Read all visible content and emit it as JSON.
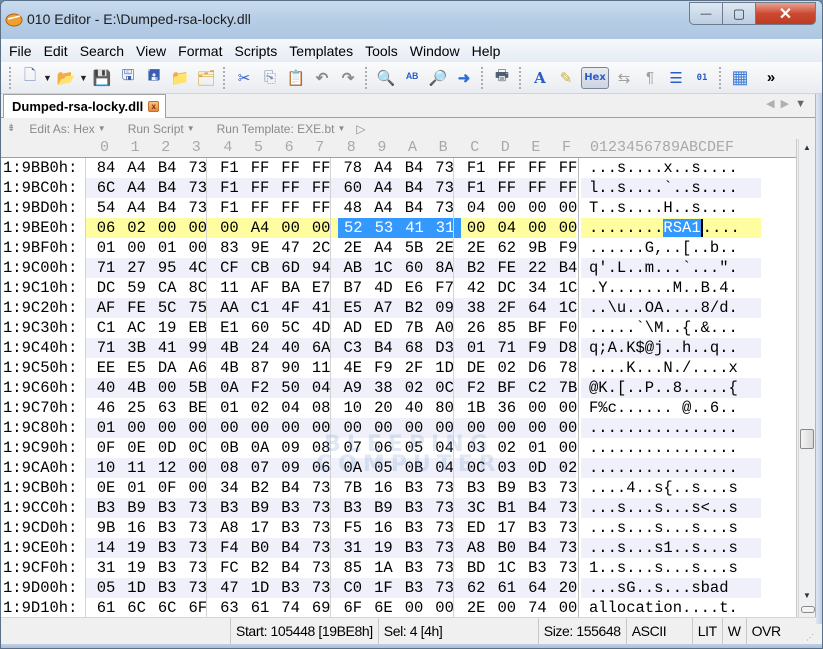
{
  "window": {
    "title": "010 Editor - E:\\Dumped-rsa-locky.dll",
    "controls": {
      "minimize": "—",
      "maximize": "▢",
      "close": "✕"
    }
  },
  "menu": [
    "File",
    "Edit",
    "Search",
    "View",
    "Format",
    "Scripts",
    "Templates",
    "Tools",
    "Window",
    "Help"
  ],
  "toolbar": {
    "icons": [
      {
        "name": "new-file-icon",
        "glyph": "🗋"
      },
      {
        "name": "open-file-icon",
        "glyph": "📂"
      },
      {
        "name": "save-icon",
        "glyph": "💾"
      },
      {
        "name": "save-as-icon",
        "glyph": "🖫"
      },
      {
        "name": "save-all-icon",
        "glyph": "🖪"
      },
      {
        "name": "open-folder-icon",
        "glyph": "📁"
      },
      {
        "name": "workspace-icon",
        "glyph": "🗂"
      },
      {
        "name": "cut-icon",
        "glyph": "✂"
      },
      {
        "name": "copy-icon",
        "glyph": "⎘"
      },
      {
        "name": "paste-icon",
        "glyph": "📋"
      },
      {
        "name": "undo-icon",
        "glyph": "↶"
      },
      {
        "name": "redo-icon",
        "glyph": "↷"
      },
      {
        "name": "find-icon",
        "glyph": "🔍"
      },
      {
        "name": "replace-icon",
        "glyph": "ᴬᴮ"
      },
      {
        "name": "find-in-files-icon",
        "glyph": "🔎"
      },
      {
        "name": "goto-icon",
        "glyph": "➜"
      },
      {
        "name": "print-icon",
        "glyph": "🖶"
      },
      {
        "name": "font-icon",
        "glyph": "A"
      },
      {
        "name": "highlight-icon",
        "glyph": "✎"
      },
      {
        "name": "columns-icon",
        "glyph": "⇆"
      },
      {
        "name": "pilcrow-icon",
        "glyph": "¶"
      },
      {
        "name": "list-view-icon",
        "glyph": "☰"
      },
      {
        "name": "binary-icon",
        "glyph": "01"
      },
      {
        "name": "calculator-icon",
        "glyph": "▦"
      }
    ],
    "hex_label": "Hex",
    "overflow": "»"
  },
  "tab": {
    "label": "Dumped-rsa-locky.dll",
    "close": "x"
  },
  "tab_nav": {
    "left": "◀",
    "right": "▶",
    "menu": "▼"
  },
  "editor_toolbar": {
    "edit_as": "Edit As: Hex",
    "run_script": "Run Script",
    "run_template": "Run Template: EXE.bt"
  },
  "column_header": {
    "hex": [
      "0",
      "1",
      "2",
      "3",
      "4",
      "5",
      "6",
      "7",
      "8",
      "9",
      "A",
      "B",
      "C",
      "D",
      "E",
      "F"
    ],
    "ascii": "0123456789ABCDEF"
  },
  "rows": [
    {
      "addr": "1:9BB0h:",
      "bytes": [
        "84",
        "A4",
        "B4",
        "73",
        "F1",
        "FF",
        "FF",
        "FF",
        "78",
        "A4",
        "B4",
        "73",
        "F1",
        "FF",
        "FF",
        "FF"
      ],
      "ascii": "...s....x..s...."
    },
    {
      "addr": "1:9BC0h:",
      "bytes": [
        "6C",
        "A4",
        "B4",
        "73",
        "F1",
        "FF",
        "FF",
        "FF",
        "60",
        "A4",
        "B4",
        "73",
        "F1",
        "FF",
        "FF",
        "FF"
      ],
      "ascii": "l..s....`..s...."
    },
    {
      "addr": "1:9BD0h:",
      "bytes": [
        "54",
        "A4",
        "B4",
        "73",
        "F1",
        "FF",
        "FF",
        "FF",
        "48",
        "A4",
        "B4",
        "73",
        "04",
        "00",
        "00",
        "00"
      ],
      "ascii": "T..s....H..s...."
    },
    {
      "addr": "1:9BE0h:",
      "bytes": [
        "06",
        "02",
        "00",
        "00",
        "00",
        "A4",
        "00",
        "00",
        "52",
        "53",
        "41",
        "31",
        "00",
        "04",
        "00",
        "00"
      ],
      "ascii": "........RSA1....",
      "highlight": true,
      "selection": [
        8,
        11
      ]
    },
    {
      "addr": "1:9BF0h:",
      "bytes": [
        "01",
        "00",
        "01",
        "00",
        "83",
        "9E",
        "47",
        "2C",
        "2E",
        "A4",
        "5B",
        "2E",
        "2E",
        "62",
        "9B",
        "F9"
      ],
      "ascii": "......G,..[..b.."
    },
    {
      "addr": "1:9C00h:",
      "bytes": [
        "71",
        "27",
        "95",
        "4C",
        "CF",
        "CB",
        "6D",
        "94",
        "AB",
        "1C",
        "60",
        "8A",
        "B2",
        "FE",
        "22",
        "B4"
      ],
      "ascii": "q'.L..m...`...\"."
    },
    {
      "addr": "1:9C10h:",
      "bytes": [
        "DC",
        "59",
        "CA",
        "8C",
        "11",
        "AF",
        "BA",
        "E7",
        "B7",
        "4D",
        "E6",
        "F7",
        "42",
        "DC",
        "34",
        "1C"
      ],
      "ascii": ".Y.......M..B.4."
    },
    {
      "addr": "1:9C20h:",
      "bytes": [
        "AF",
        "FE",
        "5C",
        "75",
        "AA",
        "C1",
        "4F",
        "41",
        "E5",
        "A7",
        "B2",
        "09",
        "38",
        "2F",
        "64",
        "1C"
      ],
      "ascii": "..\\u..OA....8/d."
    },
    {
      "addr": "1:9C30h:",
      "bytes": [
        "C1",
        "AC",
        "19",
        "EB",
        "E1",
        "60",
        "5C",
        "4D",
        "AD",
        "ED",
        "7B",
        "A0",
        "26",
        "85",
        "BF",
        "F0"
      ],
      "ascii": ".....`\\M..{.&..."
    },
    {
      "addr": "1:9C40h:",
      "bytes": [
        "71",
        "3B",
        "41",
        "99",
        "4B",
        "24",
        "40",
        "6A",
        "C3",
        "B4",
        "68",
        "D3",
        "01",
        "71",
        "F9",
        "D8"
      ],
      "ascii": "q;A.K$@j..h..q.."
    },
    {
      "addr": "1:9C50h:",
      "bytes": [
        "EE",
        "E5",
        "DA",
        "A6",
        "4B",
        "87",
        "90",
        "11",
        "4E",
        "F9",
        "2F",
        "1D",
        "DE",
        "02",
        "D6",
        "78"
      ],
      "ascii": "....K...N./....x"
    },
    {
      "addr": "1:9C60h:",
      "bytes": [
        "40",
        "4B",
        "00",
        "5B",
        "0A",
        "F2",
        "50",
        "04",
        "A9",
        "38",
        "02",
        "0C",
        "F2",
        "BF",
        "C2",
        "7B"
      ],
      "ascii": "@K.[..P..8.....{"
    },
    {
      "addr": "1:9C70h:",
      "bytes": [
        "46",
        "25",
        "63",
        "BE",
        "01",
        "02",
        "04",
        "08",
        "10",
        "20",
        "40",
        "80",
        "1B",
        "36",
        "00",
        "00"
      ],
      "ascii": "F%c...... @..6.."
    },
    {
      "addr": "1:9C80h:",
      "bytes": [
        "01",
        "00",
        "00",
        "00",
        "00",
        "00",
        "00",
        "00",
        "00",
        "00",
        "00",
        "00",
        "00",
        "00",
        "00",
        "00"
      ],
      "ascii": "................"
    },
    {
      "addr": "1:9C90h:",
      "bytes": [
        "0F",
        "0E",
        "0D",
        "0C",
        "0B",
        "0A",
        "09",
        "08",
        "07",
        "06",
        "05",
        "04",
        "03",
        "02",
        "01",
        "00"
      ],
      "ascii": "................"
    },
    {
      "addr": "1:9CA0h:",
      "bytes": [
        "10",
        "11",
        "12",
        "00",
        "08",
        "07",
        "09",
        "06",
        "0A",
        "05",
        "0B",
        "04",
        "0C",
        "03",
        "0D",
        "02"
      ],
      "ascii": "................"
    },
    {
      "addr": "1:9CB0h:",
      "bytes": [
        "0E",
        "01",
        "0F",
        "00",
        "34",
        "B2",
        "B4",
        "73",
        "7B",
        "16",
        "B3",
        "73",
        "B3",
        "B9",
        "B3",
        "73"
      ],
      "ascii": "....4..s{..s...s"
    },
    {
      "addr": "1:9CC0h:",
      "bytes": [
        "B3",
        "B9",
        "B3",
        "73",
        "B3",
        "B9",
        "B3",
        "73",
        "B3",
        "B9",
        "B3",
        "73",
        "3C",
        "B1",
        "B4",
        "73"
      ],
      "ascii": "...s...s...s<..s"
    },
    {
      "addr": "1:9CD0h:",
      "bytes": [
        "9B",
        "16",
        "B3",
        "73",
        "A8",
        "17",
        "B3",
        "73",
        "F5",
        "16",
        "B3",
        "73",
        "ED",
        "17",
        "B3",
        "73"
      ],
      "ascii": "...s...s...s...s"
    },
    {
      "addr": "1:9CE0h:",
      "bytes": [
        "14",
        "19",
        "B3",
        "73",
        "F4",
        "B0",
        "B4",
        "73",
        "31",
        "19",
        "B3",
        "73",
        "A8",
        "B0",
        "B4",
        "73"
      ],
      "ascii": "...s...s1..s...s"
    },
    {
      "addr": "1:9CF0h:",
      "bytes": [
        "31",
        "19",
        "B3",
        "73",
        "FC",
        "B2",
        "B4",
        "73",
        "85",
        "1A",
        "B3",
        "73",
        "BD",
        "1C",
        "B3",
        "73"
      ],
      "ascii": "1..s...s...s...s"
    },
    {
      "addr": "1:9D00h:",
      "bytes": [
        "05",
        "1D",
        "B3",
        "73",
        "47",
        "1D",
        "B3",
        "73",
        "C0",
        "1F",
        "B3",
        "73",
        "62",
        "61",
        "64",
        "20"
      ],
      "ascii": "...sG..s...sbad "
    },
    {
      "addr": "1:9D10h:",
      "bytes": [
        "61",
        "6C",
        "6C",
        "6F",
        "63",
        "61",
        "74",
        "69",
        "6F",
        "6E",
        "00",
        "00",
        "2E",
        "00",
        "74",
        "00"
      ],
      "ascii": "allocation....t."
    }
  ],
  "watermark": {
    "line1": "BLEEPING",
    "line2": "COMPUTER"
  },
  "status": {
    "start": "Start: 105448 [19BE8h]",
    "sel": "Sel: 4 [4h]",
    "size": "Size: 155648",
    "encoding": "ASCII",
    "endian": "LIT",
    "mode_w": "W",
    "mode_ovr": "OVR"
  },
  "colors": {
    "highlight_row": "#fefea0",
    "selection": "#3399ff",
    "alt_row": "#eff0fa"
  }
}
